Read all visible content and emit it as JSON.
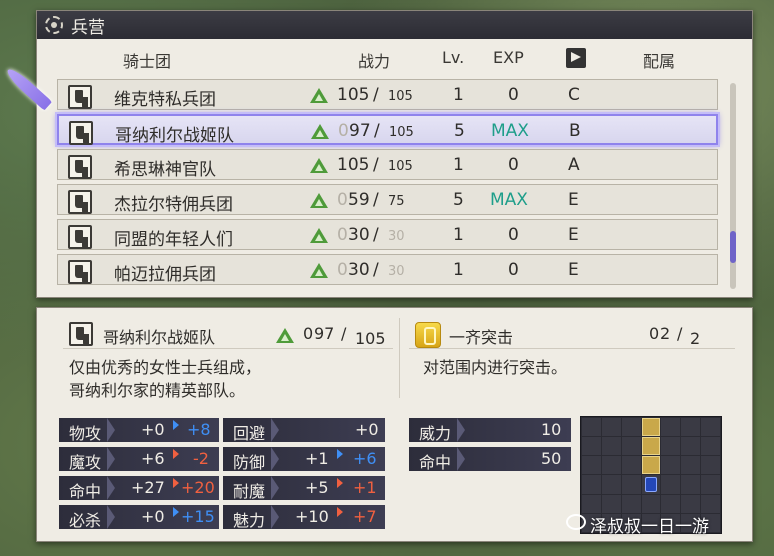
{
  "window": {
    "title": "兵营"
  },
  "table": {
    "headers": {
      "name": "骑士团",
      "power": "战力",
      "level": "Lv.",
      "exp": "EXP",
      "belong": "配属"
    },
    "rows": [
      {
        "name": "维克特私兵团",
        "power_cur": "105",
        "power_max": "105",
        "level": "1",
        "exp": "0",
        "rank": "C"
      },
      {
        "name": "哥纳利尔战姬队",
        "power_lead": "0",
        "power_cur": "97",
        "power_max": "105",
        "level": "5",
        "exp": "MAX",
        "rank": "B"
      },
      {
        "name": "希思琳神官队",
        "power_cur": "105",
        "power_max": "105",
        "level": "1",
        "exp": "0",
        "rank": "A"
      },
      {
        "name": "杰拉尔特佣兵团",
        "power_lead": "0",
        "power_cur": "59",
        "power_max": "75",
        "level": "5",
        "exp": "MAX",
        "rank": "E"
      },
      {
        "name": "同盟的年轻人们",
        "power_lead": "0",
        "power_cur": "30",
        "power_max": "30",
        "level": "1",
        "exp": "0",
        "rank": "E"
      },
      {
        "name": "帕迈拉佣兵团",
        "power_lead": "0",
        "power_cur": "30",
        "power_max": "30",
        "level": "1",
        "exp": "0",
        "rank": "E"
      }
    ]
  },
  "detail": {
    "name": "哥纳利尔战姬队",
    "power_lead": "0",
    "power_cur": "97",
    "power_max": "105",
    "description_line1": "仅由优秀的女性士兵组成，",
    "description_line2": "哥纳利尔家的精英部队。",
    "skill_name": "一齐突击",
    "skill_uses_lead": "0",
    "skill_uses_cur": "2",
    "skill_uses_max": "2",
    "skill_description": "对范围内进行突击。",
    "stats_left": [
      {
        "label": "物攻",
        "base": "+0",
        "bonus": "+8",
        "dir": "up"
      },
      {
        "label": "魔攻",
        "base": "+6",
        "bonus": "-2",
        "dir": "down"
      },
      {
        "label": "命中",
        "base": "+27",
        "bonus": "+20",
        "dir": "down"
      },
      {
        "label": "必杀",
        "base": "+0",
        "bonus": "+15",
        "dir": "up"
      }
    ],
    "stats_mid": [
      {
        "label": "回避",
        "base": "+0",
        "bonus": "",
        "dir": ""
      },
      {
        "label": "防御",
        "base": "+1",
        "bonus": "+6",
        "dir": "up"
      },
      {
        "label": "耐魔",
        "base": "+5",
        "bonus": "+1",
        "dir": "down"
      },
      {
        "label": "魅力",
        "base": "+10",
        "bonus": "+7",
        "dir": "down"
      }
    ],
    "skill_stats": [
      {
        "label": "威力",
        "value": "10"
      },
      {
        "label": "命中",
        "value": "50"
      }
    ]
  },
  "watermark": "泽叔叔一日一游",
  "colors": {
    "selection": "#8f83ec",
    "max": "#1e9e8a",
    "up": "#3f8ff5",
    "down": "#f06040"
  }
}
